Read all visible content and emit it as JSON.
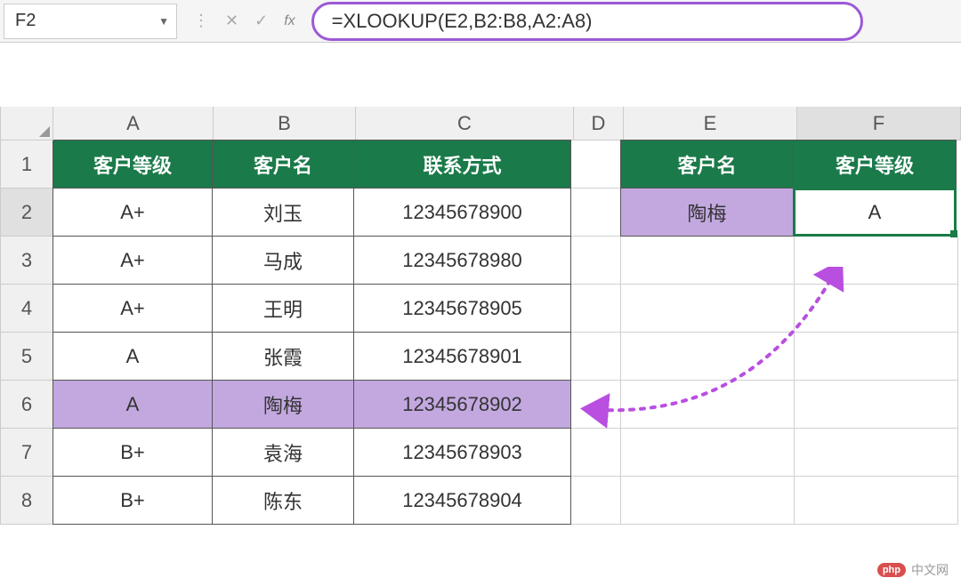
{
  "name_box": "F2",
  "formula": "=XLOOKUP(E2,B2:B8,A2:A8)",
  "columns": [
    "A",
    "B",
    "C",
    "D",
    "E",
    "F"
  ],
  "row_numbers": [
    "1",
    "2",
    "3",
    "4",
    "5",
    "6",
    "7",
    "8"
  ],
  "main_table": {
    "headers": {
      "A": "客户等级",
      "B": "客户名",
      "C": "联系方式"
    },
    "rows": [
      {
        "A": "A+",
        "B": "刘玉",
        "C": "12345678900"
      },
      {
        "A": "A+",
        "B": "马成",
        "C": "12345678980"
      },
      {
        "A": "A+",
        "B": "王明",
        "C": "12345678905"
      },
      {
        "A": "A",
        "B": "张霞",
        "C": "12345678901"
      },
      {
        "A": "A",
        "B": "陶梅",
        "C": "12345678902"
      },
      {
        "A": "B+",
        "B": "袁海",
        "C": "12345678903"
      },
      {
        "A": "B+",
        "B": "陈东",
        "C": "12345678904"
      }
    ]
  },
  "lookup_table": {
    "headers": {
      "E": "客户名",
      "F": "客户等级"
    },
    "row": {
      "E": "陶梅",
      "F": "A"
    }
  },
  "watermark": {
    "logo": "php",
    "text": "中文网"
  },
  "chart_data": {
    "type": "table",
    "title": "",
    "series": [
      {
        "name": "客户等级",
        "values": [
          "A+",
          "A+",
          "A+",
          "A",
          "A",
          "B+",
          "B+"
        ]
      },
      {
        "name": "客户名",
        "values": [
          "刘玉",
          "马成",
          "王明",
          "张霞",
          "陶梅",
          "袁海",
          "陈东"
        ]
      },
      {
        "name": "联系方式",
        "values": [
          "12345678900",
          "12345678980",
          "12345678905",
          "12345678901",
          "12345678902",
          "12345678903",
          "12345678904"
        ]
      }
    ],
    "lookup": {
      "客户名": "陶梅",
      "客户等级": "A"
    },
    "formula": "=XLOOKUP(E2,B2:B8,A2:A8)"
  }
}
